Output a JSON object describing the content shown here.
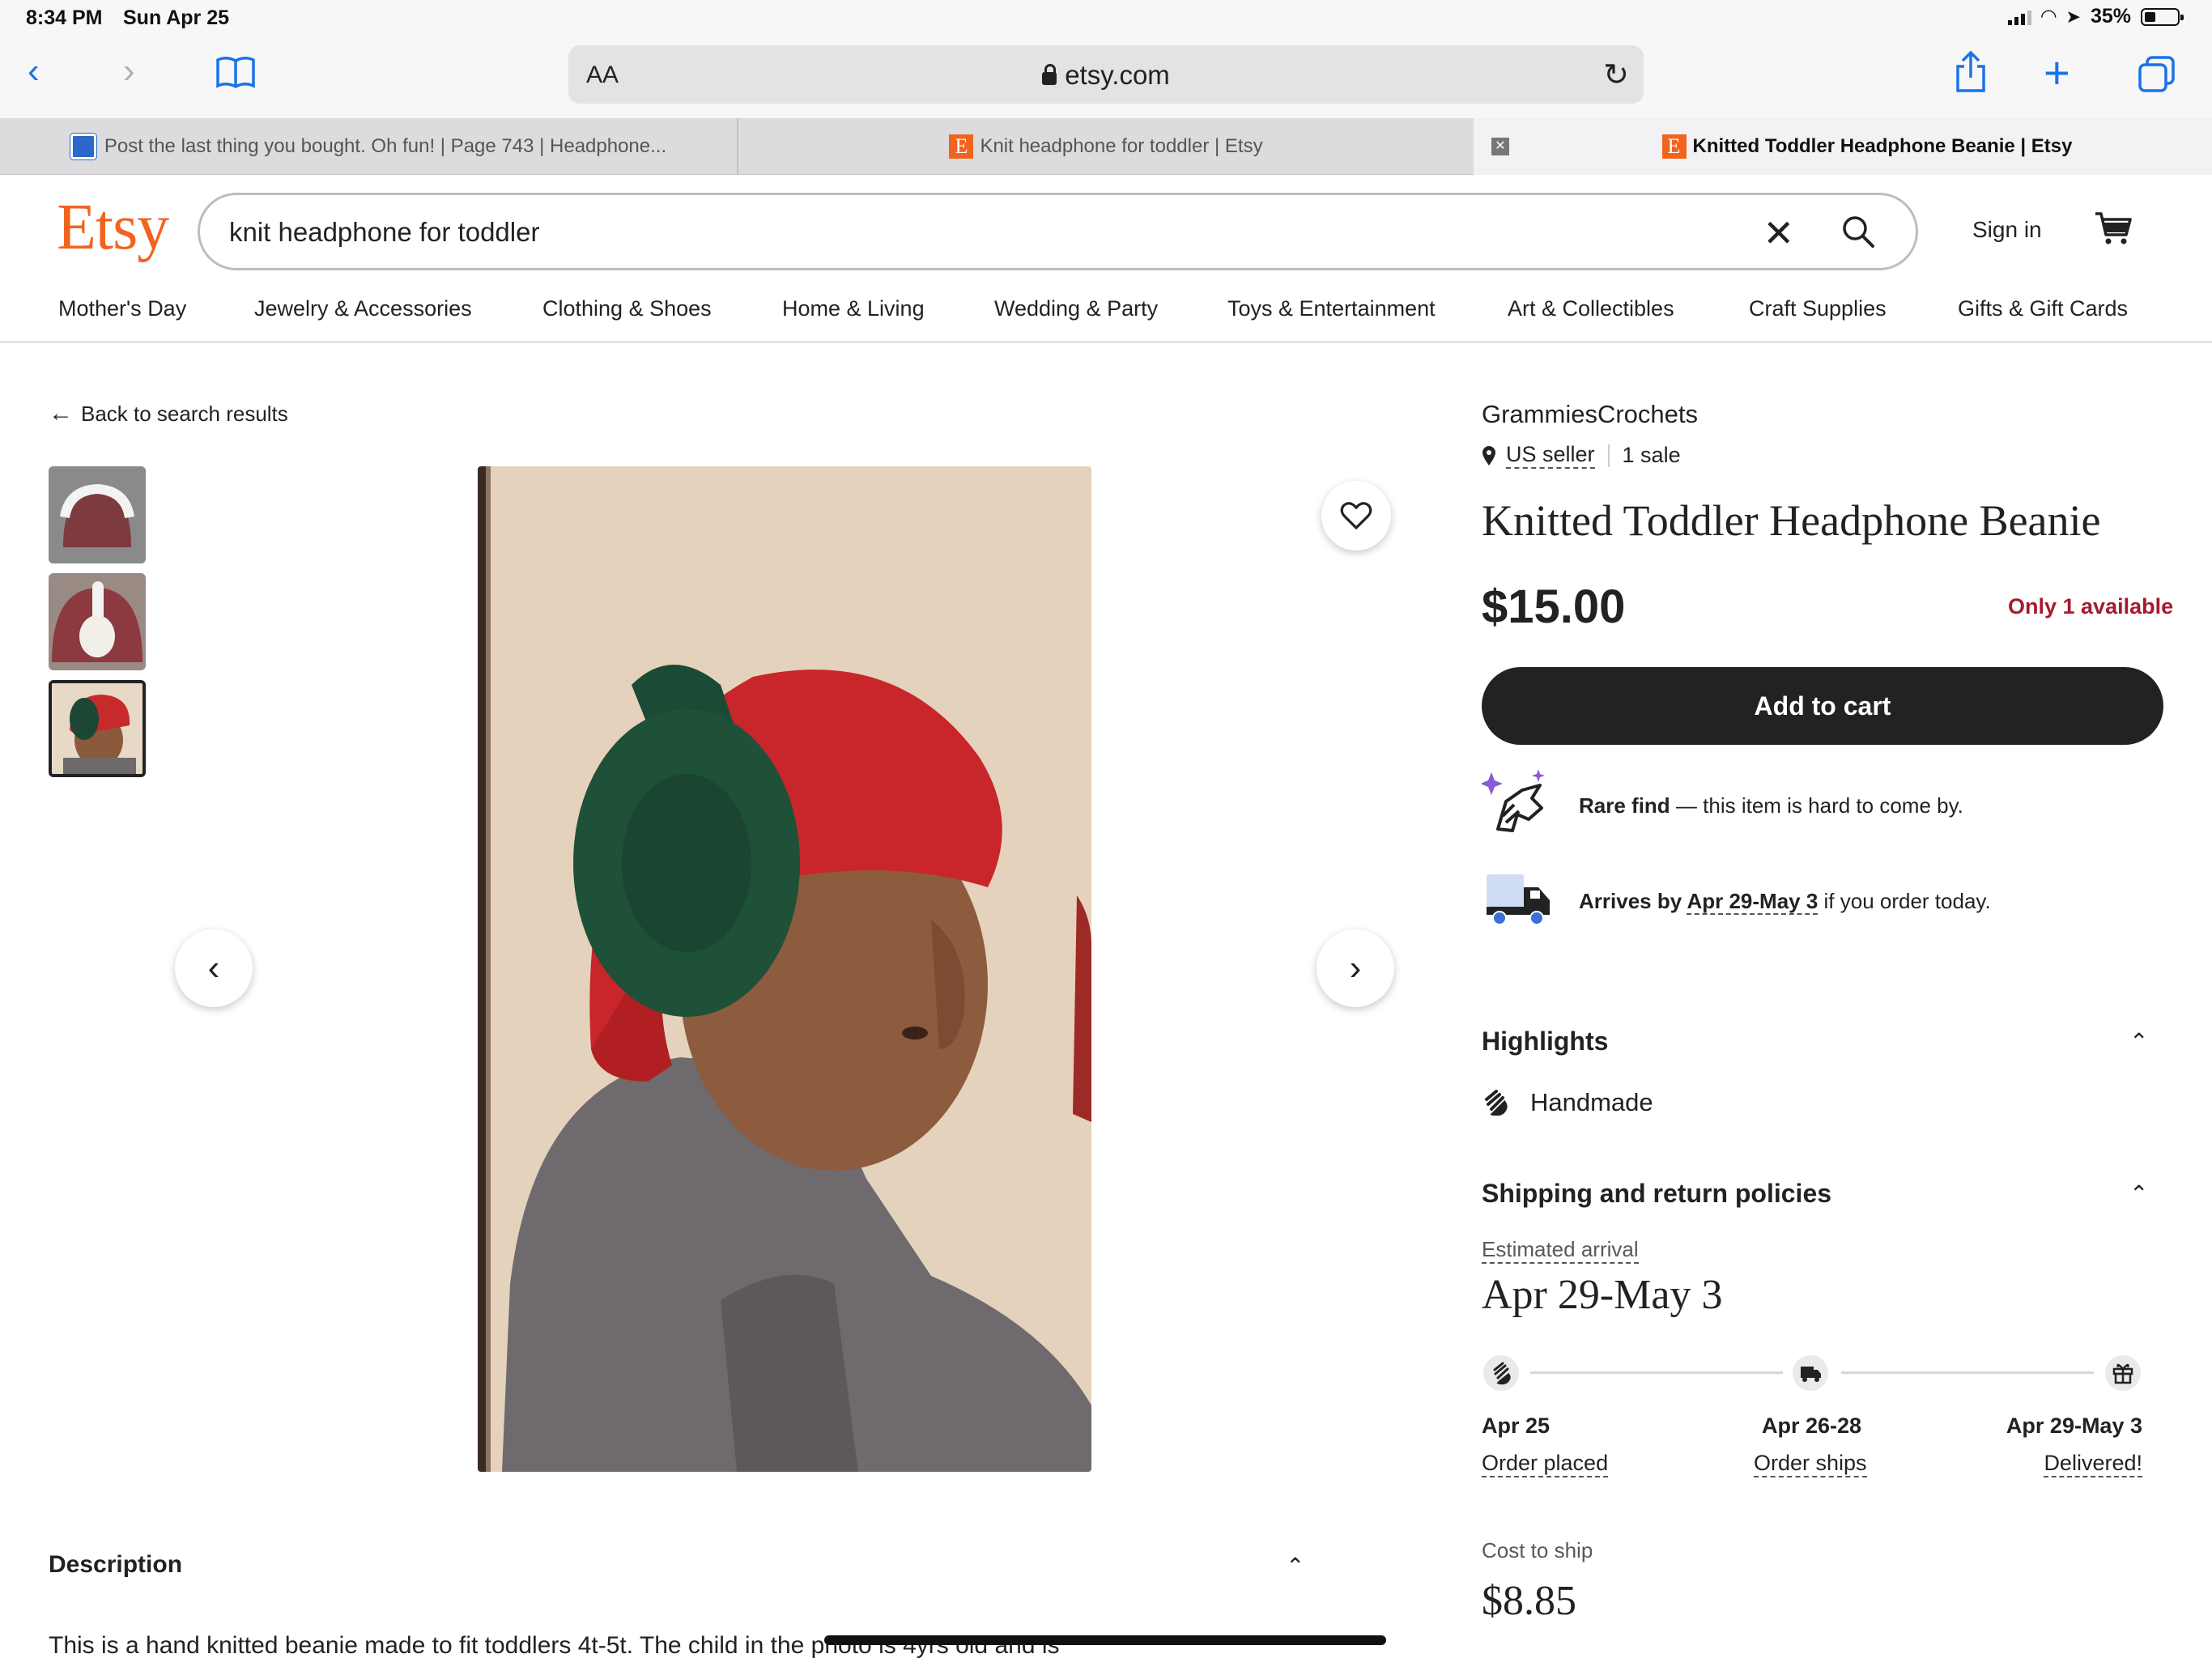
{
  "status_bar": {
    "time": "8:34 PM",
    "date": "Sun Apr 25",
    "battery": "35%"
  },
  "browser": {
    "text_size_label": "AA",
    "url": "etsy.com",
    "tabs": [
      {
        "label": "Post the last thing you bought. Oh fun! | Page 743 | Headphone..."
      },
      {
        "label": "Knit headphone for toddler | Etsy"
      },
      {
        "label": "Knitted Toddler Headphone Beanie | Etsy"
      }
    ]
  },
  "header": {
    "logo": "Etsy",
    "search_value": "knit headphone for toddler",
    "signin_label": "Sign in"
  },
  "categories": [
    "Mother's Day",
    "Jewelry & Accessories",
    "Clothing & Shoes",
    "Home & Living",
    "Wedding & Party",
    "Toys & Entertainment",
    "Art & Collectibles",
    "Craft Supplies",
    "Gifts & Gift Cards"
  ],
  "listing": {
    "back_label": "Back to search results",
    "shop_name": "GrammiesCrochets",
    "seller_location": "US seller",
    "sales": "1 sale",
    "title": "Knitted Toddler Headphone Beanie",
    "price": "$15.00",
    "availability": "Only 1 available",
    "add_to_cart": "Add to cart",
    "rare_find_bold": "Rare find",
    "rare_find_rest": " — this item is hard to come by.",
    "arrives_prefix": "Arrives by ",
    "arrives_date": "Apr 29-May 3",
    "arrives_suffix": " if you order today.",
    "highlights_title": "Highlights",
    "highlight_item": "Handmade",
    "shipping_title": "Shipping and return policies",
    "estimated_label": "Estimated arrival",
    "estimated_date": "Apr 29-May 3",
    "timeline": [
      {
        "date": "Apr 25",
        "label": "Order placed"
      },
      {
        "date": "Apr 26-28",
        "label": "Order ships"
      },
      {
        "date": "Apr 29-May 3",
        "label": "Delivered!"
      }
    ],
    "cost_label": "Cost to ship",
    "cost_value": "$8.85",
    "description_title": "Description",
    "description_text": "This is a hand knitted beanie made to fit toddlers 4t-5t. The child in the photo is 4yrs old and is"
  },
  "colors": {
    "brand": "#f1641e",
    "availability": "#a61a2e",
    "button": "#222222",
    "link_blue": "#1a73e8"
  }
}
